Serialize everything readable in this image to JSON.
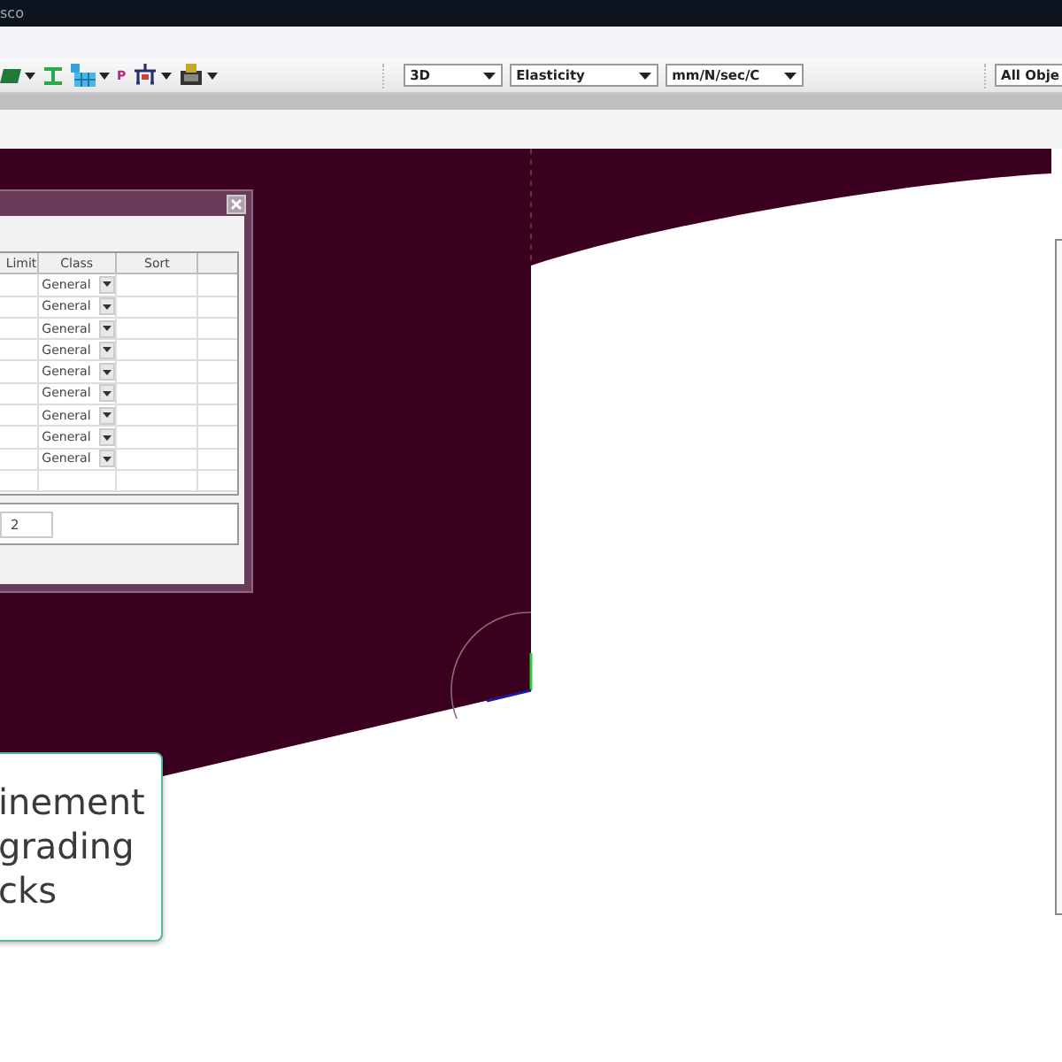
{
  "window": {
    "title": "sco"
  },
  "toolbar": {
    "tools": [
      {
        "kind": "slab",
        "dropdown": true
      },
      {
        "kind": "beam",
        "dropdown": false
      },
      {
        "kind": "table",
        "dropdown": true
      },
      {
        "kind": "glyph",
        "label": "P",
        "dropdown": false
      },
      {
        "kind": "support",
        "dropdown": true
      },
      {
        "kind": "load",
        "dropdown": true
      }
    ],
    "combos": [
      {
        "value": "3D"
      },
      {
        "value": "Elasticity"
      },
      {
        "value": "mm/N/sec/C"
      }
    ],
    "filter": {
      "value": "All Obje"
    }
  },
  "dialog": {
    "columns": [
      "Limit",
      "Class",
      "Sort",
      ""
    ],
    "rows": [
      {
        "class": "General"
      },
      {
        "class": "General"
      },
      {
        "class": "General"
      },
      {
        "class": "General"
      },
      {
        "class": "General"
      },
      {
        "class": "General"
      },
      {
        "class": "General"
      },
      {
        "class": "General"
      },
      {
        "class": "General"
      },
      {
        "class": ""
      }
    ],
    "field": {
      "value": "2"
    }
  },
  "callout": {
    "text": "inement\ngrading\ncks"
  }
}
